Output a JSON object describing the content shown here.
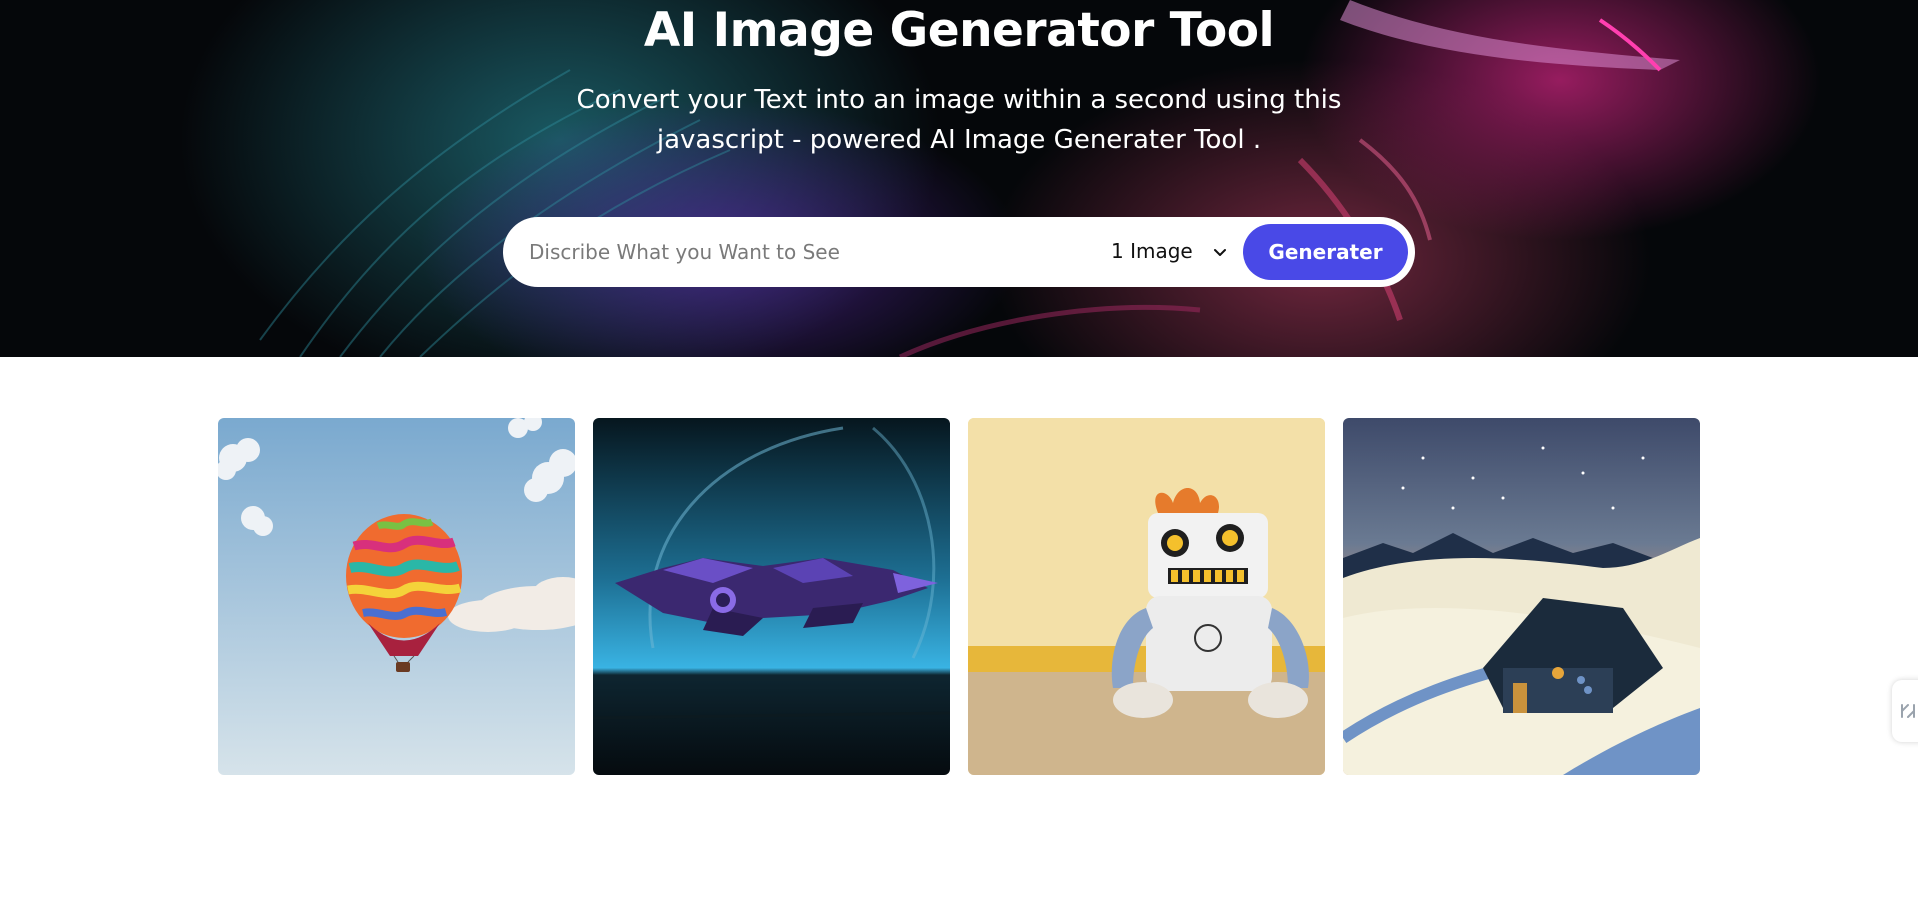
{
  "hero": {
    "title": "AI Image Generator Tool",
    "subtitle": "Convert your Text into an image within a second using this javascript - powered AI Image Generater Tool ."
  },
  "form": {
    "placeholder": "Discribe What you Want to See",
    "value": "",
    "image_count": "1 Image",
    "generate_label": "Generater"
  },
  "theme": {
    "accent": "#4949e7",
    "hero_background": "#05070a",
    "input_background": "#ffffff"
  },
  "gallery": {
    "images": [
      {
        "subject": "hot-air-balloon-image"
      },
      {
        "subject": "spaceship-image"
      },
      {
        "subject": "robot-toy-image"
      },
      {
        "subject": "snowy-cabin-image"
      }
    ]
  },
  "icons": {
    "dropdown": "chevron-down-icon",
    "side_widget": "share-icon"
  }
}
